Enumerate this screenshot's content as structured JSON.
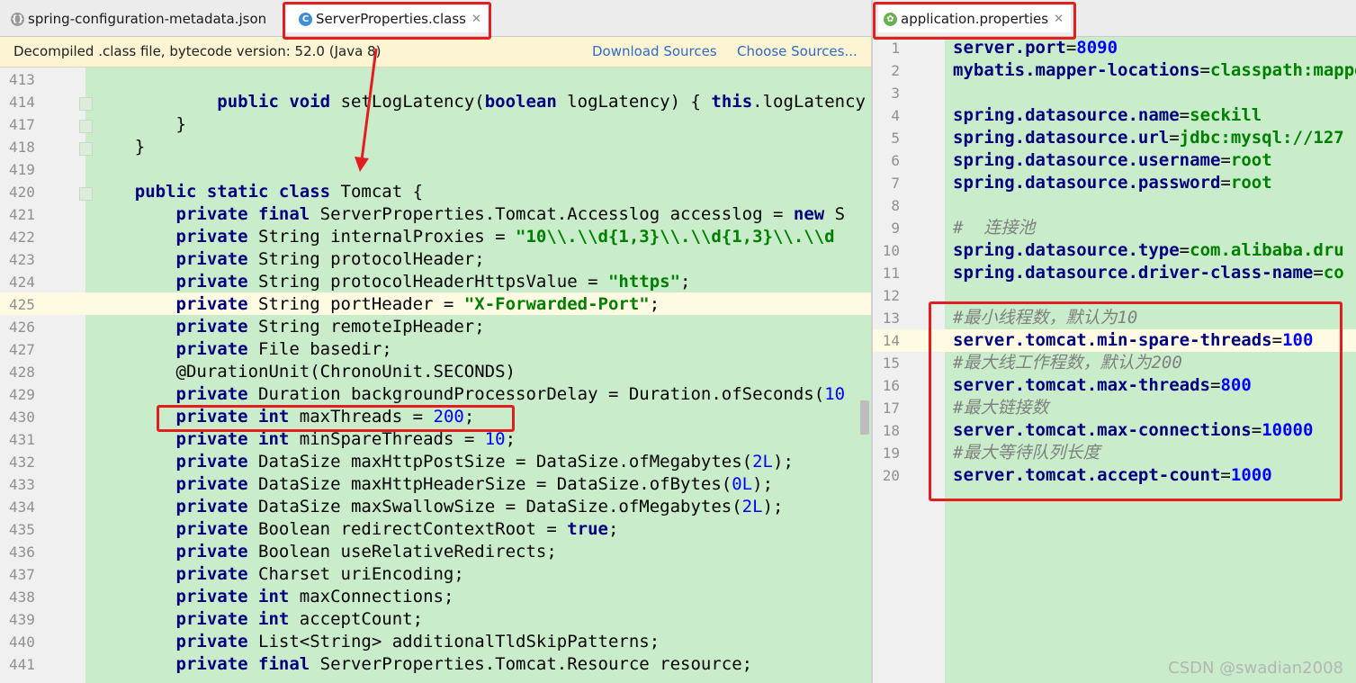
{
  "left": {
    "tabs": [
      {
        "label": "spring-configuration-metadata.json",
        "icon": "json-file-icon"
      },
      {
        "label": "ServerProperties.class",
        "icon": "class-file-icon"
      }
    ],
    "info_bar": {
      "message": "Decompiled .class file, bytecode version: 52.0 (Java 8)",
      "download_sources": "Download Sources",
      "choose_sources": "Choose Sources..."
    },
    "lines": [
      {
        "n": "413",
        "t": []
      },
      {
        "n": "414",
        "t": [
          [
            "",
            "            "
          ],
          [
            "kw",
            "public void "
          ],
          [
            "",
            "setLogLatency("
          ],
          [
            "kw",
            "boolean "
          ],
          [
            "",
            "logLatency) { "
          ],
          [
            "kw",
            "this"
          ],
          [
            "",
            ".logLatency"
          ]
        ]
      },
      {
        "n": "417",
        "t": [
          [
            "",
            "        }"
          ]
        ]
      },
      {
        "n": "418",
        "t": [
          [
            "",
            "    }"
          ]
        ]
      },
      {
        "n": "419",
        "t": []
      },
      {
        "n": "420",
        "t": [
          [
            "",
            "    "
          ],
          [
            "kw",
            "public static class "
          ],
          [
            "",
            "Tomcat {"
          ]
        ]
      },
      {
        "n": "421",
        "t": [
          [
            "",
            "        "
          ],
          [
            "kw",
            "private final "
          ],
          [
            "",
            "ServerProperties.Tomcat.Accesslog accesslog = "
          ],
          [
            "kw",
            "new "
          ],
          [
            "",
            "S"
          ]
        ]
      },
      {
        "n": "422",
        "t": [
          [
            "",
            "        "
          ],
          [
            "kw",
            "private "
          ],
          [
            "",
            "String internalProxies = "
          ],
          [
            "str",
            "\"10\\\\.\\\\d{1,3}\\\\.\\\\d{1,3}\\\\.\\\\d"
          ]
        ]
      },
      {
        "n": "423",
        "t": [
          [
            "",
            "        "
          ],
          [
            "kw",
            "private "
          ],
          [
            "",
            "String protocolHeader;"
          ]
        ]
      },
      {
        "n": "424",
        "t": [
          [
            "",
            "        "
          ],
          [
            "kw",
            "private "
          ],
          [
            "",
            "String protocolHeaderHttpsValue = "
          ],
          [
            "str",
            "\"https\""
          ],
          [
            "",
            ";"
          ]
        ]
      },
      {
        "n": "425",
        "t": [
          [
            "",
            "        "
          ],
          [
            "kw",
            "private "
          ],
          [
            "",
            "String portHeader = "
          ],
          [
            "str",
            "\"X-Forwarded-Port\""
          ],
          [
            "",
            ";"
          ]
        ]
      },
      {
        "n": "426",
        "t": [
          [
            "",
            "        "
          ],
          [
            "kw",
            "private "
          ],
          [
            "",
            "String remoteIpHeader;"
          ]
        ]
      },
      {
        "n": "427",
        "t": [
          [
            "",
            "        "
          ],
          [
            "kw",
            "private "
          ],
          [
            "",
            "File basedir;"
          ]
        ]
      },
      {
        "n": "428",
        "t": [
          [
            "",
            "        @DurationUnit(ChronoUnit.SECONDS)"
          ]
        ]
      },
      {
        "n": "429",
        "t": [
          [
            "",
            "        "
          ],
          [
            "kw",
            "private "
          ],
          [
            "",
            "Duration backgroundProcessorDelay = Duration.ofSeconds("
          ],
          [
            "num",
            "10"
          ]
        ]
      },
      {
        "n": "430",
        "t": [
          [
            "",
            "        "
          ],
          [
            "kw",
            "private int "
          ],
          [
            "",
            "maxThreads = "
          ],
          [
            "num",
            "200"
          ],
          [
            "",
            ";"
          ]
        ]
      },
      {
        "n": "431",
        "t": [
          [
            "",
            "        "
          ],
          [
            "kw",
            "private int "
          ],
          [
            "",
            "minSpareThreads = "
          ],
          [
            "num",
            "10"
          ],
          [
            "",
            ";"
          ]
        ]
      },
      {
        "n": "432",
        "t": [
          [
            "",
            "        "
          ],
          [
            "kw",
            "private "
          ],
          [
            "",
            "DataSize maxHttpPostSize = DataSize.ofMegabytes("
          ],
          [
            "num",
            "2L"
          ],
          [
            "",
            ");"
          ]
        ]
      },
      {
        "n": "433",
        "t": [
          [
            "",
            "        "
          ],
          [
            "kw",
            "private "
          ],
          [
            "",
            "DataSize maxHttpHeaderSize = DataSize.ofBytes("
          ],
          [
            "num",
            "0L"
          ],
          [
            "",
            ");"
          ]
        ]
      },
      {
        "n": "434",
        "t": [
          [
            "",
            "        "
          ],
          [
            "kw",
            "private "
          ],
          [
            "",
            "DataSize maxSwallowSize = DataSize.ofMegabytes("
          ],
          [
            "num",
            "2L"
          ],
          [
            "",
            ");"
          ]
        ]
      },
      {
        "n": "435",
        "t": [
          [
            "",
            "        "
          ],
          [
            "kw",
            "private "
          ],
          [
            "",
            "Boolean redirectContextRoot = "
          ],
          [
            "kw",
            "true"
          ],
          [
            "",
            ";"
          ]
        ]
      },
      {
        "n": "436",
        "t": [
          [
            "",
            "        "
          ],
          [
            "kw",
            "private "
          ],
          [
            "",
            "Boolean useRelativeRedirects;"
          ]
        ]
      },
      {
        "n": "437",
        "t": [
          [
            "",
            "        "
          ],
          [
            "kw",
            "private "
          ],
          [
            "",
            "Charset uriEncoding;"
          ]
        ]
      },
      {
        "n": "438",
        "t": [
          [
            "",
            "        "
          ],
          [
            "kw",
            "private int "
          ],
          [
            "",
            "maxConnections;"
          ]
        ]
      },
      {
        "n": "439",
        "t": [
          [
            "",
            "        "
          ],
          [
            "kw",
            "private int "
          ],
          [
            "",
            "acceptCount;"
          ]
        ]
      },
      {
        "n": "440",
        "t": [
          [
            "",
            "        "
          ],
          [
            "kw",
            "private "
          ],
          [
            "",
            "List<String> additionalTldSkipPatterns;"
          ]
        ]
      },
      {
        "n": "441",
        "t": [
          [
            "",
            "        "
          ],
          [
            "kw",
            "private final "
          ],
          [
            "",
            "ServerProperties.Tomcat.Resource resource;"
          ]
        ]
      }
    ]
  },
  "right": {
    "tab": {
      "label": "application.properties",
      "icon": "spring-leaf-icon"
    },
    "lines": [
      {
        "n": "1",
        "t": [
          [
            "pk",
            "server.port"
          ],
          [
            "",
            "="
          ],
          [
            "pn",
            "8090"
          ]
        ]
      },
      {
        "n": "2",
        "t": [
          [
            "pk",
            "mybatis.mapper-locations"
          ],
          [
            "",
            "="
          ],
          [
            "pv",
            "classpath:mapper"
          ]
        ]
      },
      {
        "n": "3",
        "t": []
      },
      {
        "n": "4",
        "t": [
          [
            "pk",
            "spring.datasource.name"
          ],
          [
            "",
            "="
          ],
          [
            "pv",
            "seckill"
          ]
        ]
      },
      {
        "n": "5",
        "t": [
          [
            "pk",
            "spring.datasource.url"
          ],
          [
            "",
            "="
          ],
          [
            "pv",
            "jdbc:mysql://127"
          ]
        ]
      },
      {
        "n": "6",
        "t": [
          [
            "pk",
            "spring.datasource.username"
          ],
          [
            "",
            "="
          ],
          [
            "pv",
            "root"
          ]
        ]
      },
      {
        "n": "7",
        "t": [
          [
            "pk",
            "spring.datasource.password"
          ],
          [
            "",
            "="
          ],
          [
            "pv",
            "root"
          ]
        ]
      },
      {
        "n": "8",
        "t": []
      },
      {
        "n": "9",
        "t": [
          [
            "cmt",
            "#  连接池"
          ]
        ]
      },
      {
        "n": "10",
        "t": [
          [
            "pk",
            "spring.datasource.type"
          ],
          [
            "",
            "="
          ],
          [
            "pv",
            "com.alibaba.dru"
          ]
        ]
      },
      {
        "n": "11",
        "t": [
          [
            "pk",
            "spring.datasource.driver-class-name"
          ],
          [
            "",
            "="
          ],
          [
            "pv",
            "co"
          ]
        ]
      },
      {
        "n": "12",
        "t": []
      },
      {
        "n": "13",
        "t": [
          [
            "cmt",
            "#最小线程数，默认为10"
          ]
        ]
      },
      {
        "n": "14",
        "t": [
          [
            "pk",
            "server.tomcat.min-spare-threads"
          ],
          [
            "",
            "="
          ],
          [
            "pn",
            "100"
          ]
        ]
      },
      {
        "n": "15",
        "t": [
          [
            "cmt",
            "#最大线工作程数，默认为200"
          ]
        ]
      },
      {
        "n": "16",
        "t": [
          [
            "pk",
            "server.tomcat.max-threads"
          ],
          [
            "",
            "="
          ],
          [
            "pn",
            "800"
          ]
        ]
      },
      {
        "n": "17",
        "t": [
          [
            "cmt",
            "#最大链接数"
          ]
        ]
      },
      {
        "n": "18",
        "t": [
          [
            "pk",
            "server.tomcat.max-connections"
          ],
          [
            "",
            "="
          ],
          [
            "pn",
            "10000"
          ]
        ]
      },
      {
        "n": "19",
        "t": [
          [
            "cmt",
            "#最大等待队列长度"
          ]
        ]
      },
      {
        "n": "20",
        "t": [
          [
            "pk",
            "server.tomcat.accept-count"
          ],
          [
            "",
            "="
          ],
          [
            "pn",
            "1000"
          ]
        ]
      }
    ]
  },
  "watermark": "CSDN @swadian2008",
  "colors": {
    "annotation": "#e41e1e",
    "code_background": "#c9ecca",
    "info_bar": "#fcf4d3"
  }
}
